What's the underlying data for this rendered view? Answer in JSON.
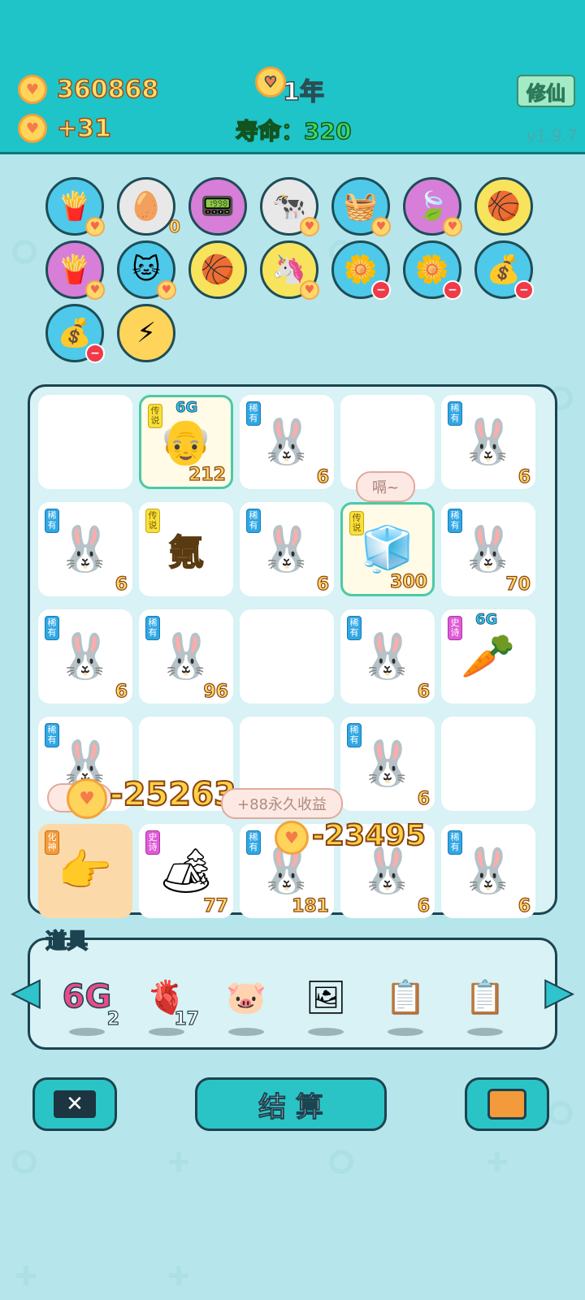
{
  "header": {
    "gold": "360868",
    "income": "+31",
    "year_suffix": "1年",
    "life": "寿命：320",
    "cultivate_label": "修仙",
    "version": "v1.9.7"
  },
  "effects": [
    {
      "icon": "fries-icon",
      "glyph": "🍟",
      "bg": "#4ec9ea",
      "badge": "heart"
    },
    {
      "icon": "egg-tray-icon",
      "glyph": "🥚",
      "bg": "#e8e8e8",
      "badge": "count",
      "count": "0"
    },
    {
      "icon": "pink-device-icon",
      "glyph": "📟",
      "bg": "#d77ed8",
      "badge": ""
    },
    {
      "icon": "cows-icon",
      "glyph": "🐄",
      "bg": "#e8e8e8",
      "badge": "heart"
    },
    {
      "icon": "fruit-basket-icon",
      "glyph": "🧺",
      "bg": "#4ec9ea",
      "badge": "heart"
    },
    {
      "icon": "leaf-icon",
      "glyph": "🍃",
      "bg": "#d77ed8",
      "badge": "heart"
    },
    {
      "icon": "basketballs-icon",
      "glyph": "🏀",
      "bg": "#f8e35d",
      "badge": ""
    },
    {
      "icon": "fries-icon",
      "glyph": "🍟",
      "bg": "#d77ed8",
      "badge": "heart"
    },
    {
      "icon": "cat-icon",
      "glyph": "🐱",
      "bg": "#4ec9ea",
      "badge": "heart"
    },
    {
      "icon": "basketballs-icon",
      "glyph": "🏀",
      "bg": "#f8e35d",
      "badge": ""
    },
    {
      "icon": "unicorn-icon",
      "glyph": "🦄",
      "bg": "#f8e35d",
      "badge": "heart"
    },
    {
      "icon": "flower-pot-icon",
      "glyph": "🌼",
      "bg": "#4ec9ea",
      "badge": "minus"
    },
    {
      "icon": "flower-pot-icon",
      "glyph": "🌼",
      "bg": "#4ec9ea",
      "badge": "minus"
    },
    {
      "icon": "money-bag-icon",
      "glyph": "💰",
      "bg": "#4ec9ea",
      "badge": "minus"
    },
    {
      "icon": "money-bag-icon",
      "glyph": "💰",
      "bg": "#4ec9ea",
      "badge": "minus"
    },
    {
      "icon": "lightning-coin-icon",
      "glyph": "⚡",
      "bg": "#ffd45b",
      "badge": ""
    }
  ],
  "board": {
    "cells": [
      {
        "type": "empty"
      },
      {
        "type": "legend",
        "tag": "传说",
        "art": "👴",
        "count": "212",
        "sixg": "6G",
        "icon": "old-man-icon"
      },
      {
        "type": "rare",
        "tag": "稀有",
        "art": "🐰",
        "count": "6",
        "icon": "rabbit-icon"
      },
      {
        "type": "empty"
      },
      {
        "type": "rare",
        "tag": "稀有",
        "art": "🐰",
        "count": "6",
        "icon": "rabbit-icon"
      },
      {
        "type": "rare",
        "tag": "稀有",
        "art": "🐰",
        "count": "6",
        "icon": "rabbit-icon"
      },
      {
        "type": "legend",
        "tag": "传说",
        "art": "氪",
        "count": "",
        "icon": "krypton-character"
      },
      {
        "type": "rare",
        "tag": "稀有",
        "art": "🐰",
        "count": "6",
        "icon": "rabbit-icon"
      },
      {
        "type": "legend",
        "tag": "传说",
        "art": "🧊",
        "count": "300",
        "icon": "fridge-watermelon-icon"
      },
      {
        "type": "rare",
        "tag": "稀有",
        "art": "🐰",
        "count": "70",
        "icon": "rabbit-icon"
      },
      {
        "type": "rare",
        "tag": "稀有",
        "art": "🐰",
        "count": "6",
        "icon": "rabbit-icon"
      },
      {
        "type": "rare",
        "tag": "稀有",
        "art": "🐰",
        "count": "96",
        "icon": "rabbit-icon"
      },
      {
        "type": "empty"
      },
      {
        "type": "rare",
        "tag": "稀有",
        "art": "🐰",
        "count": "6",
        "icon": "rabbit-icon"
      },
      {
        "type": "epic",
        "tag": "史诗",
        "art": "🥕",
        "count": "",
        "sixg": "6G",
        "icon": "carrot-icon"
      },
      {
        "type": "rare",
        "tag": "稀有",
        "art": "🐰",
        "count": "",
        "icon": "rabbit-icon"
      },
      {
        "type": "empty"
      },
      {
        "type": "empty"
      },
      {
        "type": "rare",
        "tag": "稀有",
        "art": "🐰",
        "count": "6",
        "icon": "rabbit-icon"
      },
      {
        "type": "empty"
      },
      {
        "type": "god",
        "tag": "化神",
        "art": "👉",
        "count": "",
        "icon": "pointing-hand-icon"
      },
      {
        "type": "epic",
        "tag": "史诗",
        "art": "🏕",
        "count": "77",
        "icon": "rabbit-tent-icon"
      },
      {
        "type": "rare",
        "tag": "稀有",
        "art": "🐰",
        "count": "181",
        "icon": "rabbit-icon"
      },
      {
        "type": "rare",
        "tag": "",
        "art": "🐰",
        "count": "6",
        "icon": "rabbit-icon"
      },
      {
        "type": "rare",
        "tag": "稀有",
        "art": "🐰",
        "count": "6",
        "icon": "rabbit-icon"
      }
    ],
    "speech_bubble": "嗝~",
    "float_loss_1": "-25263",
    "float_loss_2": "-23495",
    "float_income": "+88永久收益"
  },
  "tools": {
    "title": "道具",
    "items": [
      {
        "icon": "6g-icon",
        "glyph": "6G",
        "count": "2"
      },
      {
        "icon": "liver-icon",
        "glyph": "🫀",
        "count": "17"
      },
      {
        "icon": "piggy-bank-icon",
        "glyph": "🐷",
        "count": ""
      },
      {
        "icon": "portrait-icon",
        "glyph": "🖼",
        "count": ""
      },
      {
        "icon": "copy-paste-frame-icon",
        "glyph": "📋",
        "count": ""
      },
      {
        "icon": "copy-paste-frame-icon",
        "glyph": "📋",
        "count": ""
      }
    ]
  },
  "buttons": {
    "settle_label": "结 算"
  }
}
